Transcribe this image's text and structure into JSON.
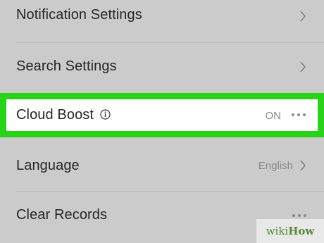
{
  "settings": {
    "notification": {
      "label": "Notification Settings"
    },
    "search": {
      "label": "Search Settings"
    },
    "cloud_boost": {
      "label": "Cloud Boost",
      "value": "ON"
    },
    "language": {
      "label": "Language",
      "value": "English"
    },
    "clear_records": {
      "label": "Clear Records"
    }
  },
  "watermark": {
    "wiki": "wiki",
    "how": "How"
  },
  "colors": {
    "background": "#cbcbcb",
    "highlight_border": "#2ad21a",
    "highlight_fill": "#ffffff",
    "label_text": "#262626",
    "value_text": "#8a8a8a"
  }
}
